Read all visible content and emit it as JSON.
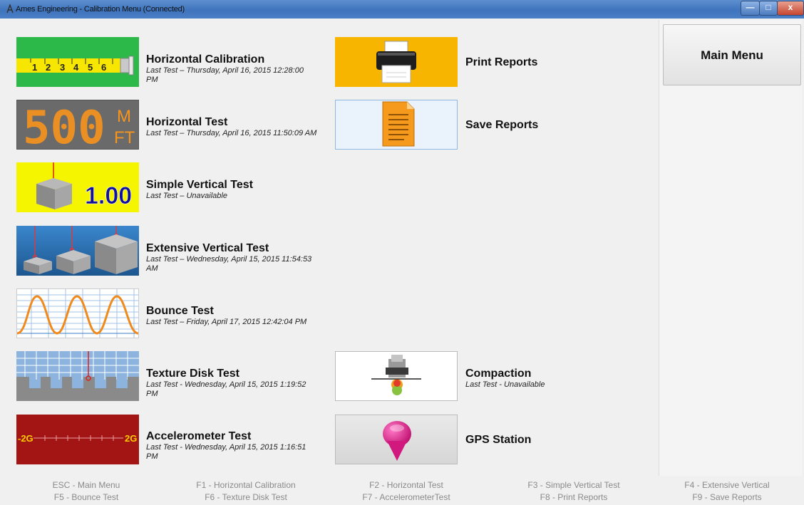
{
  "window": {
    "title": "Ames Engineering - Calibration Menu (Connected)",
    "controls": {
      "minimize": "—",
      "maximize": "□",
      "close": "x"
    }
  },
  "sidebar": {
    "main_menu_label": "Main Menu"
  },
  "tests": [
    {
      "name": "Horizontal Calibration",
      "last_test": "Last Test – Thursday, April 16, 2015 12:28:00 PM",
      "icon": "tape-measure-icon",
      "ruler_numbers": [
        "1",
        "2",
        "3",
        "4",
        "5",
        "6"
      ]
    },
    {
      "name": "Horizontal Test",
      "last_test": "Last Test – Thursday, April 16, 2015 11:50:09 AM",
      "icon": "distance-display-icon",
      "display_value": "500",
      "display_units": [
        "M",
        "FT"
      ]
    },
    {
      "name": "Simple Vertical Test",
      "last_test": "Last Test – Unavailable",
      "icon": "block-height-icon",
      "display_value": "1.00"
    },
    {
      "name": "Extensive Vertical Test",
      "last_test": "Last Test – Wednesday, April 15, 2015 11:54:53 AM",
      "icon": "three-blocks-icon"
    },
    {
      "name": "Bounce Test",
      "last_test": "Last Test – Friday, April 17, 2015 12:42:04 PM",
      "icon": "waveform-icon"
    },
    {
      "name": "Texture Disk Test",
      "last_test": "Last Test - Wednesday, April 15, 2015 1:19:52 PM",
      "icon": "texture-disk-icon"
    },
    {
      "name": "Accelerometer Test",
      "last_test": "Last Test - Wednesday, April 15, 2015 1:16:51 PM",
      "icon": "accelerometer-scale-icon",
      "scale_left": "-2G",
      "scale_right": "2G"
    }
  ],
  "reports": [
    {
      "name": "Print Reports",
      "icon": "printer-icon"
    },
    {
      "name": "Save Reports",
      "icon": "document-icon"
    }
  ],
  "extras": [
    {
      "name": "Compaction",
      "last_test": "Last Test - Unavailable",
      "icon": "compaction-icon"
    },
    {
      "name": "GPS Station",
      "icon": "gps-pin-icon"
    }
  ],
  "shortcuts": [
    [
      "ESC - Main Menu",
      "F5 - Bounce Test"
    ],
    [
      "F1 - Horizontal Calibration",
      "F6 - Texture Disk Test"
    ],
    [
      "F2 - Horizontal Test",
      "F7 - AccelerometerTest"
    ],
    [
      "F3 - Simple Vertical Test",
      "F8 - Print Reports"
    ],
    [
      "F4 - Extensive Vertical",
      "F9 - Save Reports"
    ]
  ],
  "colors": {
    "tape_green": "#2db84a",
    "display_bg": "#6a6a6a",
    "display_orange": "#f7941d",
    "yellow_bg": "#f5f500",
    "blue_bg": "#2f73b8",
    "accel_red": "#a31515",
    "print_orange": "#f7b500",
    "gps_pink": "#e0198a"
  }
}
